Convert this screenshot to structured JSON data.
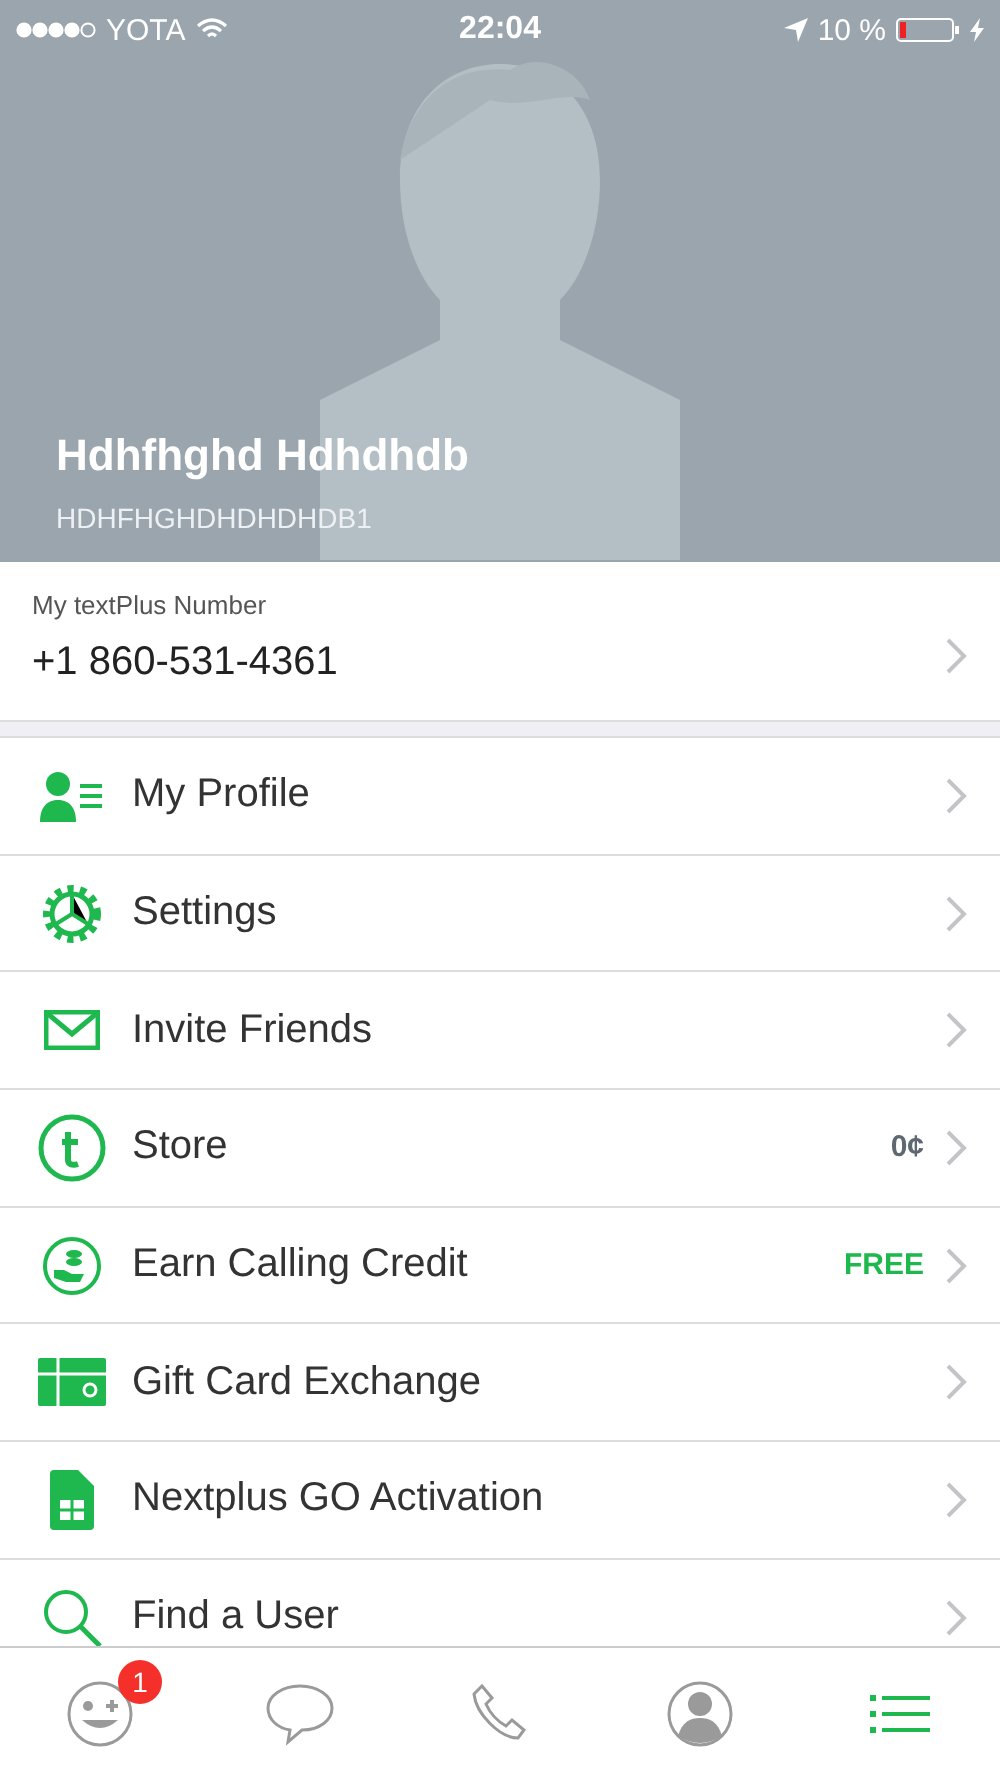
{
  "status_bar": {
    "carrier": "YOTA",
    "time": "22:04",
    "battery": "10 %"
  },
  "profile": {
    "name": "Hdhfhghd Hdhdhdb",
    "username": "HDHFHGHDHDHDHDB1"
  },
  "number": {
    "label": "My textPlus Number",
    "value": "+1 860-531-4361"
  },
  "menu": [
    {
      "label": "My Profile"
    },
    {
      "label": "Settings"
    },
    {
      "label": "Invite Friends"
    },
    {
      "label": "Store",
      "value": "0¢",
      "color": "#5f6770"
    },
    {
      "label": "Earn Calling Credit",
      "value": "FREE",
      "color": "#1fb84e"
    },
    {
      "label": "Gift Card Exchange"
    },
    {
      "label": "Nextplus GO Activation"
    },
    {
      "label": "Find a User"
    }
  ],
  "tab_bar": [
    {
      "selected": false,
      "badge": "1"
    },
    {
      "selected": false
    },
    {
      "selected": false
    },
    {
      "selected": false
    },
    {
      "selected": true
    }
  ]
}
